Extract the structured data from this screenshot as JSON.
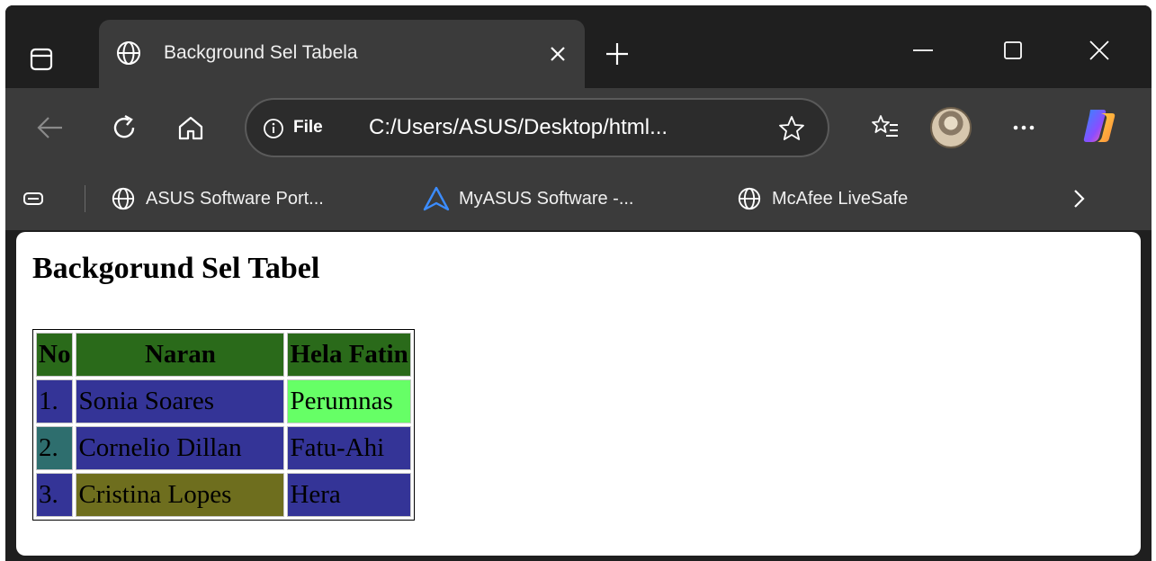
{
  "browser": {
    "tab_title": "Background Sel Tabela",
    "address": {
      "scheme": "File",
      "url": "C:/Users/ASUS/Desktop/html..."
    },
    "favorites": [
      {
        "label": "ASUS Software Port...",
        "icon": "globe-icon"
      },
      {
        "label": "MyASUS Software -...",
        "icon": "myasus-icon"
      },
      {
        "label": "McAfee LiveSafe",
        "icon": "globe-icon"
      }
    ],
    "more_label": "···"
  },
  "page": {
    "heading": "Backgorund Sel Tabel",
    "table": {
      "headers": [
        "No",
        "Naran",
        "Hela Fatin"
      ],
      "rows": [
        [
          "1.",
          "Sonia Soares",
          "Perumnas"
        ],
        [
          "2.",
          "Cornelio Dillan",
          "Fatu-Ahi"
        ],
        [
          "3.",
          "Cristina Lopes",
          "Hera"
        ]
      ],
      "header_bg": "#2a6a1a",
      "cell_colors": [
        [
          "#343497",
          "#343497",
          "#66ff66"
        ],
        [
          "#2e6e6e",
          "#343497",
          "#343497"
        ],
        [
          "#343497",
          "#6e6e1e",
          "#343497"
        ]
      ]
    }
  },
  "colors": {
    "chrome_dark": "#1f1f1f",
    "chrome_tab": "#3b3b3b",
    "copilot_gradient": [
      "#2f8bff",
      "#8a4dff",
      "#ff8a3d",
      "#ffd23d"
    ]
  }
}
